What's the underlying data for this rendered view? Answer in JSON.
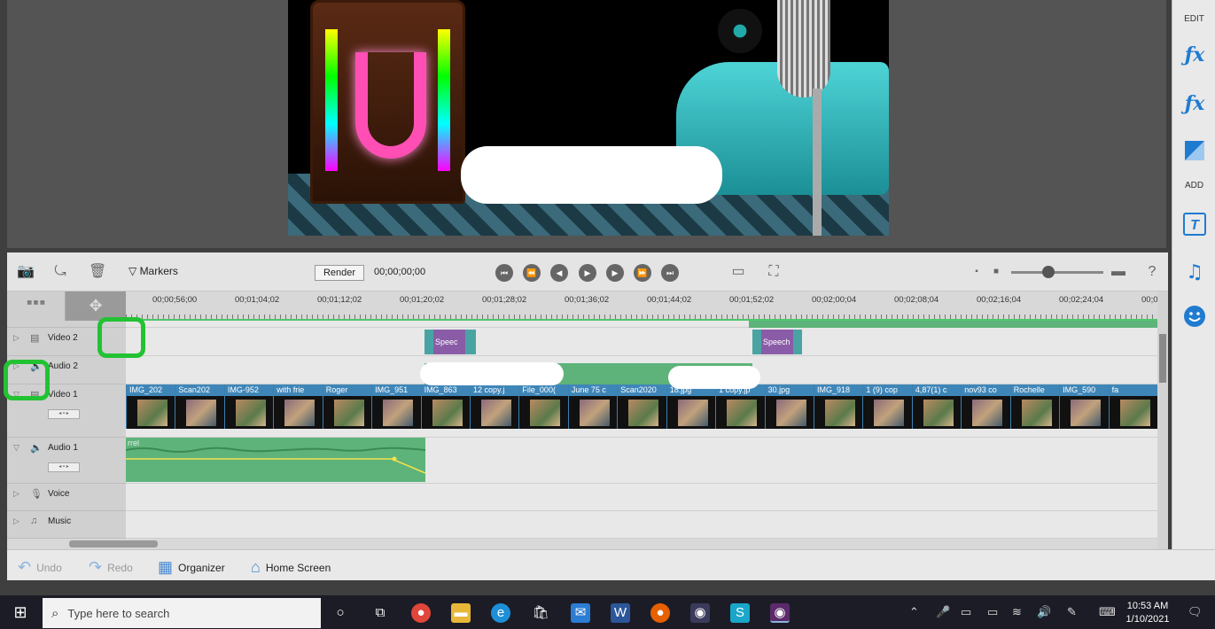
{
  "right_panel": {
    "edit_label": "EDIT",
    "add_label": "ADD",
    "edit_icons": [
      "fx-pencil-icon",
      "fx-icon",
      "adjustment-icon"
    ],
    "add_icons": [
      "title-icon",
      "music-note-icon",
      "smiley-icon"
    ]
  },
  "toolbar": {
    "markers_label": "Markers",
    "render_label": "Render",
    "timecode": "00;00;00;00"
  },
  "ruler": {
    "ticks": [
      "00;00;56;00",
      "00;01;04;02",
      "00;01;12;02",
      "00;01;20;02",
      "00;01;28;02",
      "00;01;36;02",
      "00;01;44;02",
      "00;01;52;02",
      "00;02;00;04",
      "00;02;08;04",
      "00;02;16;04",
      "00;02;24;04",
      "00;0"
    ]
  },
  "tracks": {
    "video2": "Video 2",
    "audio2": "Audio 2",
    "video1": "Video 1",
    "audio1": "Audio 1",
    "voice": "Voice",
    "music": "Music"
  },
  "video2_clips": [
    "Speec",
    "Speech"
  ],
  "video1_clips": [
    "IMG_202",
    "Scan202",
    "IMG-952",
    "with frie",
    "Roger",
    "IMG_951",
    "IMG_863",
    "12 copy.j",
    "File_000(",
    "June 75 c",
    "Scan2020",
    "18.jpg",
    "1 copy.jp",
    "30.jpg",
    "IMG_918",
    "1 (9) cop",
    "4,87(1) c",
    "nov93 co",
    "Rochelle",
    "IMG_590",
    "fa"
  ],
  "audio1_clip": "rrel",
  "bottom_bar": {
    "undo": "Undo",
    "redo": "Redo",
    "organizer": "Organizer",
    "home": "Home Screen"
  },
  "taskbar": {
    "search_placeholder": "Type here to search",
    "time": "10:53 AM",
    "date": "1/10/2021"
  },
  "colors": {
    "accent_blue": "#1f7bd0",
    "clip_blue": "#3f86b8",
    "audio_green": "#5db37a",
    "speech_purple": "#8a5ca8",
    "highlight_green": "#22c233"
  }
}
